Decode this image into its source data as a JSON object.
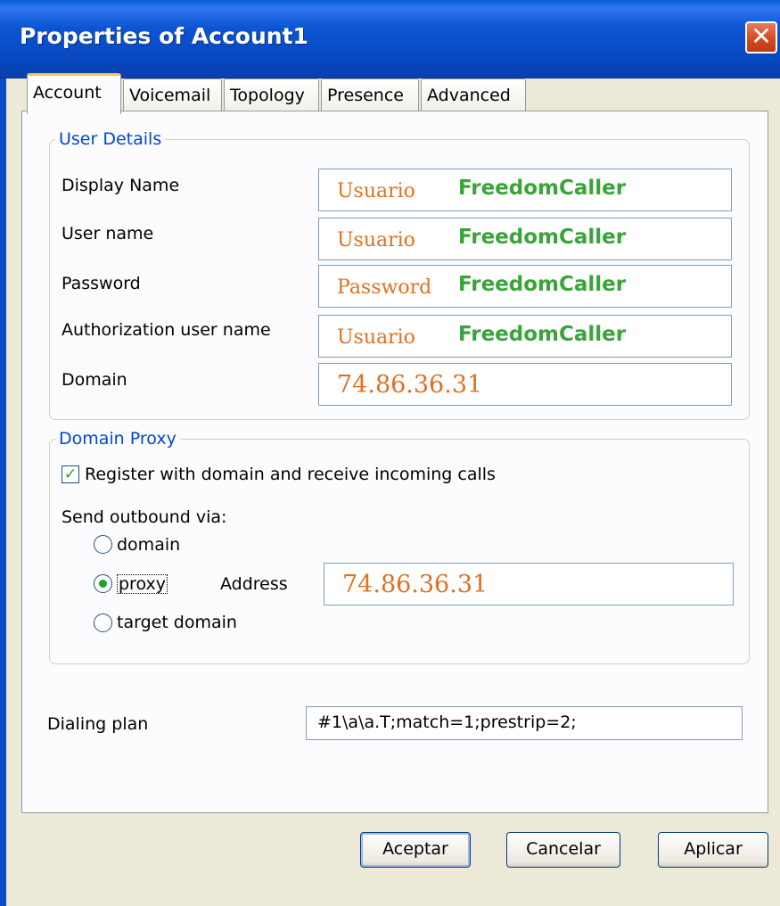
{
  "window": {
    "title": "Properties of Account1",
    "close_glyph": "✕"
  },
  "tabs": [
    {
      "label": "Account",
      "active": true
    },
    {
      "label": "Voicemail",
      "active": false
    },
    {
      "label": "Topology",
      "active": false
    },
    {
      "label": "Presence",
      "active": false
    },
    {
      "label": "Advanced",
      "active": false
    }
  ],
  "user_details": {
    "legend": "User Details",
    "display_name": {
      "label": "Display Name",
      "value_prefix": "Usuario",
      "value_user": "FreedomCaller"
    },
    "user_name": {
      "label": "User name",
      "value_prefix": "Usuario",
      "value_user": "FreedomCaller"
    },
    "password": {
      "label": "Password",
      "value_prefix": "Password",
      "value_user": "FreedomCaller"
    },
    "auth_user_name": {
      "label": "Authorization user name",
      "value_prefix": "Usuario",
      "value_user": "FreedomCaller"
    },
    "domain": {
      "label": "Domain",
      "value": "74.86.36.31"
    }
  },
  "domain_proxy": {
    "legend": "Domain Proxy",
    "register_checkbox": {
      "label": "Register with domain and receive incoming calls",
      "checked": true,
      "glyph": "✓"
    },
    "send_outbound_label": "Send outbound via:",
    "options": [
      {
        "label": "domain",
        "selected": false
      },
      {
        "label": "proxy",
        "selected": true
      },
      {
        "label": "target domain",
        "selected": false
      }
    ],
    "address_label": "Address",
    "address_value": "74.86.36.31"
  },
  "dialing_plan": {
    "label": "Dialing plan",
    "value": "#1\\a\\a.T;match=1;prestrip=2;"
  },
  "buttons": {
    "ok": "Aceptar",
    "cancel": "Cancelar",
    "apply": "Aplicar"
  },
  "colors": {
    "title_bar": "#0a52d0",
    "legend_text": "#0046d5",
    "overlay_orange": "#e0701f",
    "overlay_green": "#3aa43a"
  },
  "icons": {
    "close": "close-icon",
    "checkbox": "check-icon",
    "radio": "radio-icon"
  }
}
